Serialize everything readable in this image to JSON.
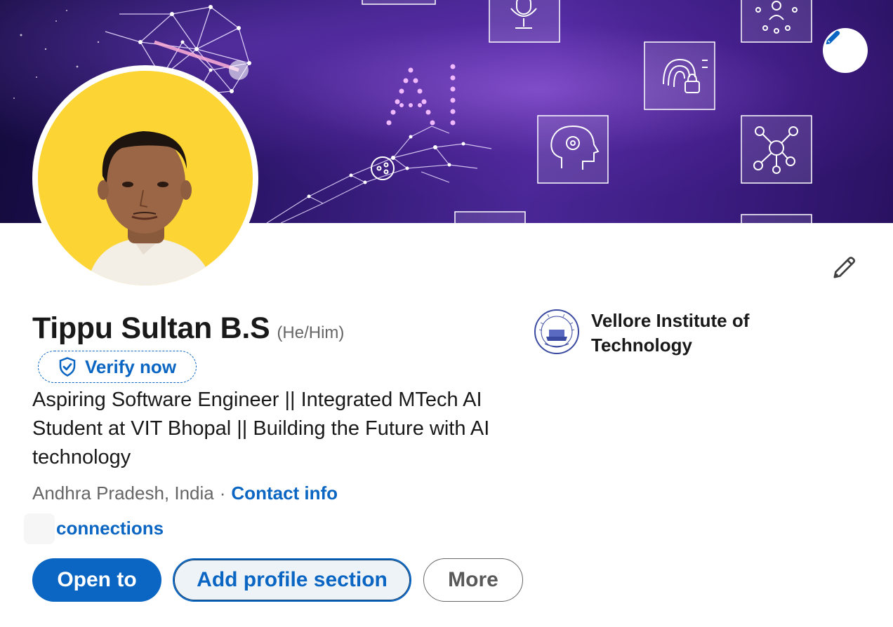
{
  "banner": {
    "text": "AI",
    "icons": [
      "microphone-icon",
      "person-network-icon",
      "fingerprint-lock-icon",
      "head-gear-icon",
      "network-nodes-icon"
    ],
    "edit_icon": "pencil-icon"
  },
  "profile": {
    "name": "Tippu Sultan B.S",
    "pronouns": "(He/Him)",
    "verify_label": "Verify now",
    "headline": "Aspiring Software Engineer || Integrated MTech AI Student at VIT Bhopal || Building the Future with AI technology",
    "location": "Andhra Pradesh, India",
    "separator": "·",
    "contact_label": "Contact info",
    "connections_label": "connections",
    "edit_icon": "pencil-icon"
  },
  "actions": {
    "open_to": "Open to",
    "add_section": "Add profile section",
    "more": "More"
  },
  "education": {
    "name": "Vellore Institute of Technology",
    "logo_text": "VIT"
  },
  "colors": {
    "accent": "#0a66c2",
    "banner": "#3b1c80",
    "avatar_bg": "#fcd535"
  }
}
